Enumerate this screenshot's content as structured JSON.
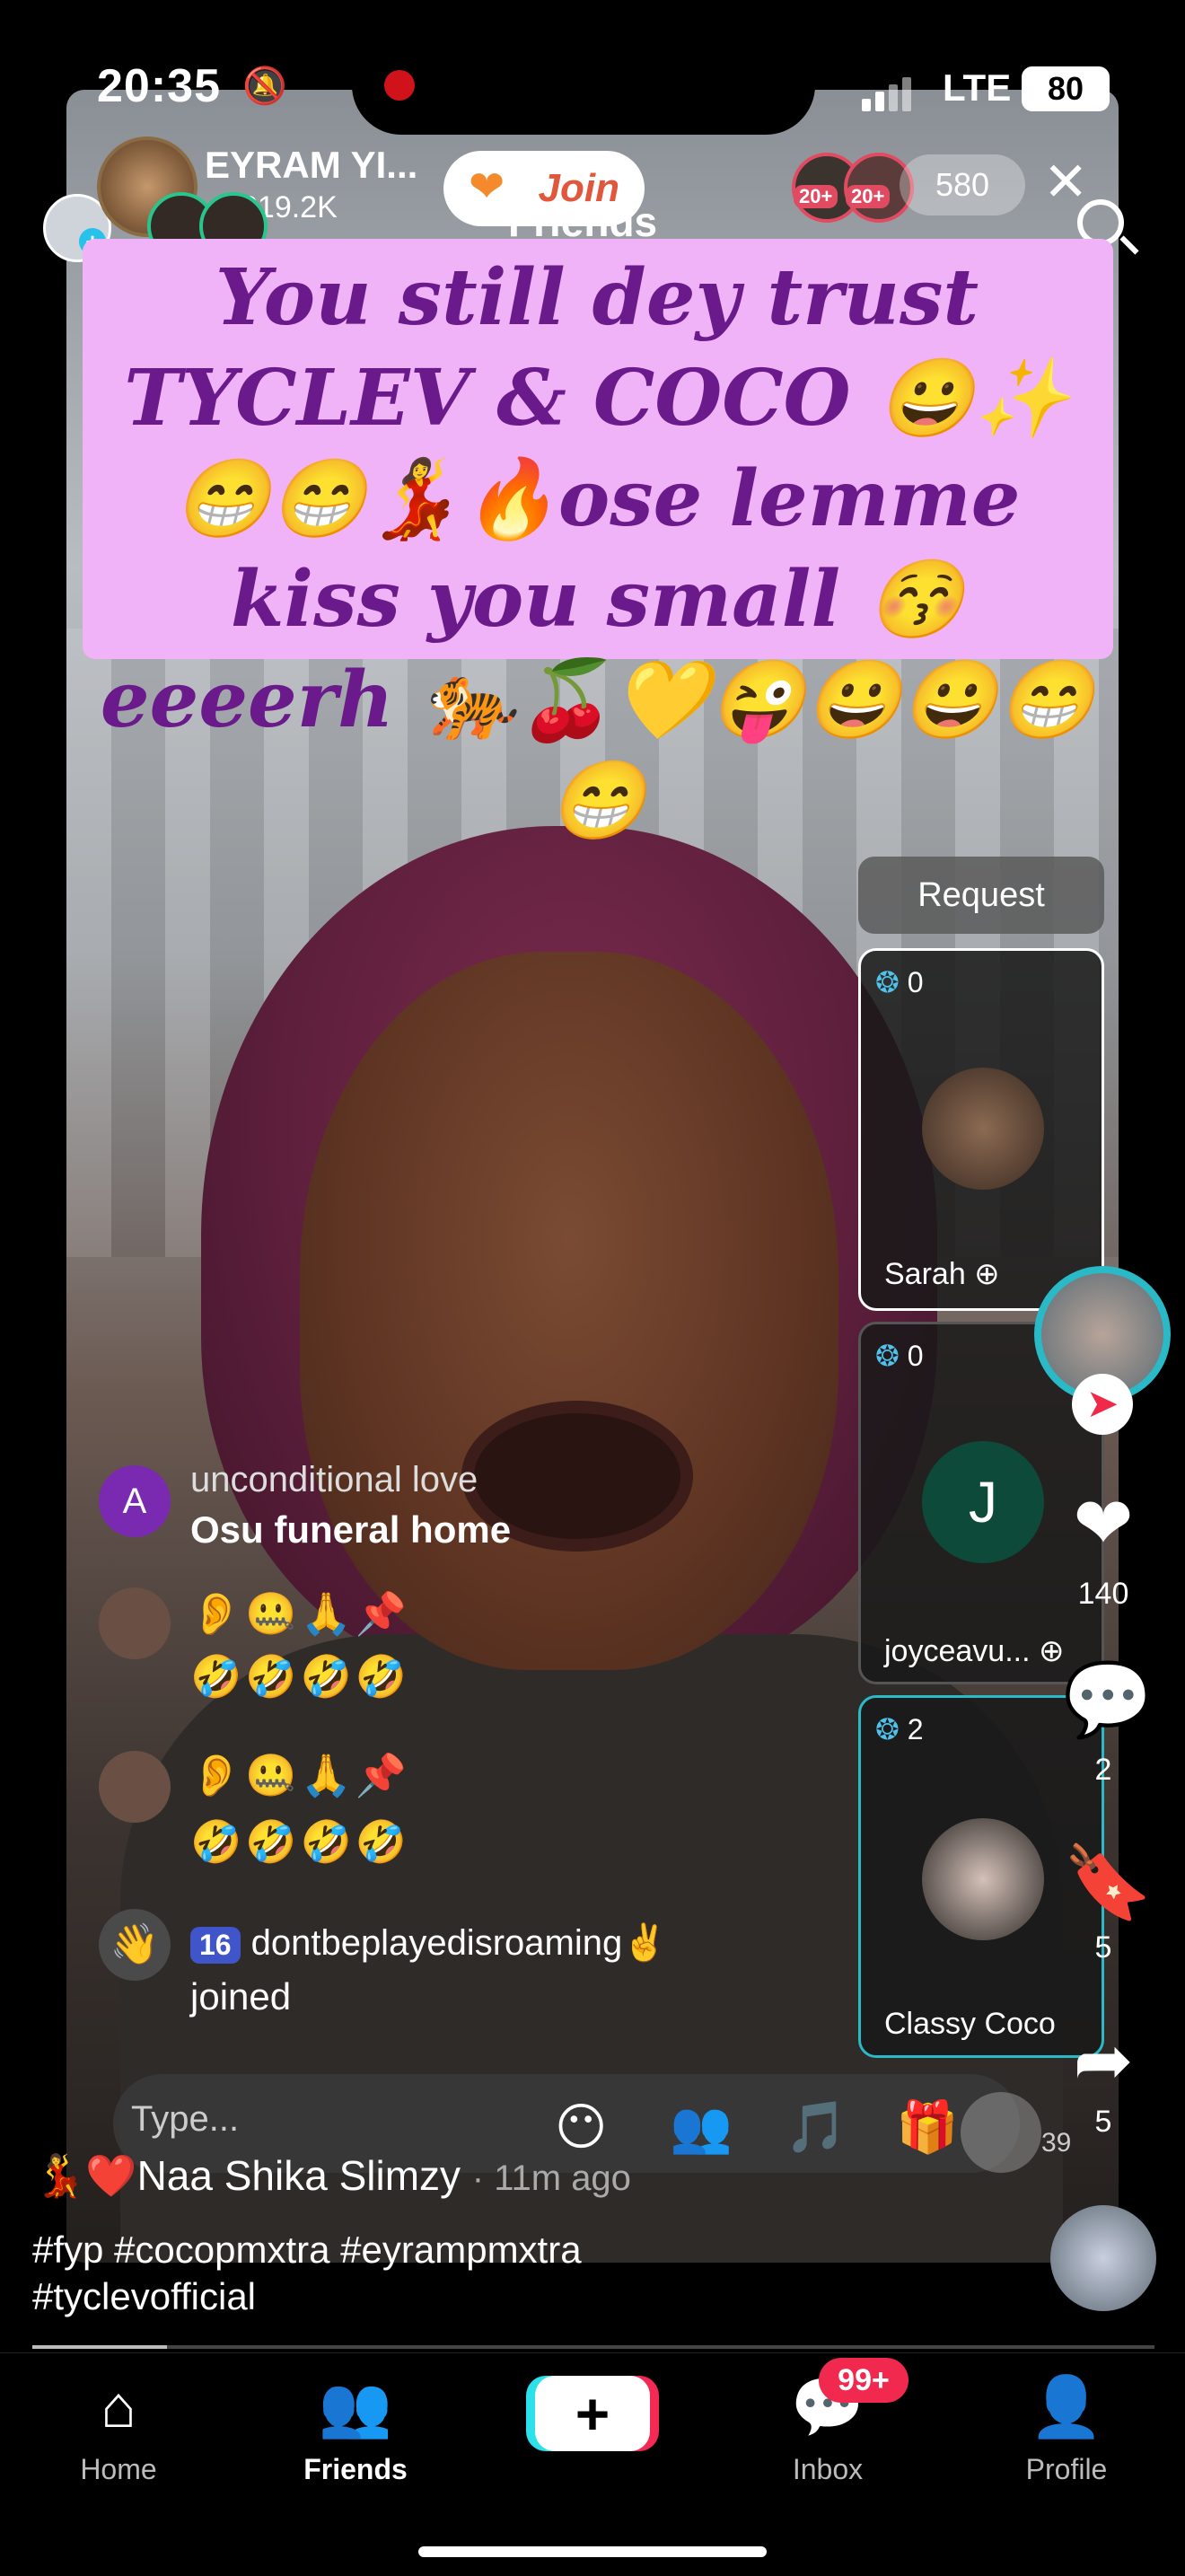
{
  "status_bar": {
    "time": "20:35",
    "network": "LTE",
    "battery": "80"
  },
  "live_header": {
    "host_name": "EYRAM YI...",
    "host_followers": "219.2K",
    "join_label": "Join",
    "viewer_badge_1": "20+",
    "viewer_badge_2": "20+",
    "viewer_count": "580",
    "friends_label": "Friends"
  },
  "banner": {
    "text": "You still dey trust TYCLEV & COCO 😀✨😁😁💃🔥ose lemme kiss you small 😚 eeeerh 🐅🍒💛😜😀😀😁😁"
  },
  "cohosts": {
    "request_label": "Request",
    "guests": [
      {
        "score": "0",
        "name": "Sarah",
        "initial": ""
      },
      {
        "score": "0",
        "name": "joyceavu...",
        "initial": "J"
      },
      {
        "score": "2",
        "name": "Classy Coco",
        "initial": ""
      }
    ]
  },
  "actions": {
    "likes": "140",
    "comments": "2",
    "saves": "5",
    "shares": "5",
    "gift_count": "39"
  },
  "chat": [
    {
      "avatar_initial": "A",
      "name": "unconditional love",
      "text": "Osu funeral home"
    },
    {
      "line1": "👂🤐🙏📌",
      "line2": "🤣🤣🤣🤣"
    },
    {
      "line1": "👂🤐🙏📌",
      "line2": "🤣🤣🤣🤣"
    },
    {
      "level": "16",
      "name": "dontbeplayedisroaming✌️",
      "text": "joined"
    }
  ],
  "composer": {
    "placeholder": "Type..."
  },
  "video_info": {
    "author": "Naa Shika Slimzy",
    "author_prefix": "💃❤️",
    "time": "· 11m ago",
    "hashtags": "#fyp #cocopmxtra #eyrampmxtra #tyclevofficial"
  },
  "tabs": [
    {
      "label": "Home",
      "icon": "home-icon"
    },
    {
      "label": "Friends",
      "icon": "friends-icon"
    },
    {
      "label": "",
      "icon": "create-icon"
    },
    {
      "label": "Inbox",
      "icon": "inbox-icon",
      "badge": "99+"
    },
    {
      "label": "Profile",
      "icon": "profile-icon"
    }
  ],
  "colors": {
    "banner_bg": "#f0b3f7",
    "banner_text": "#6a1a8a",
    "accent_red": "#f2294e",
    "accent_cyan": "#2de1ea"
  }
}
